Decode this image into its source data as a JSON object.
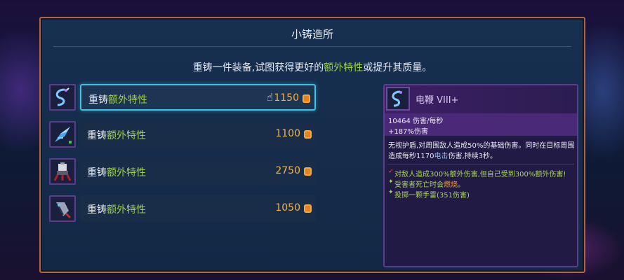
{
  "panel": {
    "title": "小铸造所",
    "subtitle_pre": "重铸一件装备,试图获得更好的",
    "subtitle_highlight": "额外特性",
    "subtitle_post": "或提升其质量。"
  },
  "options": [
    {
      "label_pre": "重铸",
      "label_highlight": "额外特性",
      "price": "1150",
      "selected": true,
      "icon": "electric-whip-icon"
    },
    {
      "label_pre": "重铸",
      "label_highlight": "额外特性",
      "price": "1100",
      "selected": false,
      "icon": "crystal-shard-icon"
    },
    {
      "label_pre": "重铸",
      "label_highlight": "额外特性",
      "price": "2750",
      "selected": false,
      "icon": "turret-icon"
    },
    {
      "label_pre": "重铸",
      "label_highlight": "额外特性",
      "price": "1050",
      "selected": false,
      "icon": "shield-blade-icon"
    }
  ],
  "item": {
    "name": "电鞭  VIII+",
    "dps": "10464 伤害/每秒",
    "bonus": "+187%伤害",
    "desc_pre": "无视护盾,对周围敌人造成50%的基础伤害。同时在目标周围造成每秒1170",
    "desc_highlight": "电击",
    "desc_post": "伤害,持续3秒。",
    "traits": [
      {
        "pre": "对敌人造成300%额外伤害,但自己受到300%额外伤害!",
        "highlight": "",
        "post": "",
        "bullet_color": "#e0452c"
      },
      {
        "pre": "受害者死亡时会",
        "highlight": "燃烧",
        "post": "。",
        "bullet_color": "#b2d45a"
      },
      {
        "pre": "投掷一颗手雷(351伤害)",
        "highlight": "",
        "post": "",
        "bullet_color": "#b2d45a"
      }
    ]
  },
  "colors": {
    "border": "#b8623a",
    "highlight_green": "#9ed04a",
    "price_gold": "#f0b24a",
    "select_cyan": "#3ec3e6",
    "rarity_purple": "#5a3d8c"
  }
}
